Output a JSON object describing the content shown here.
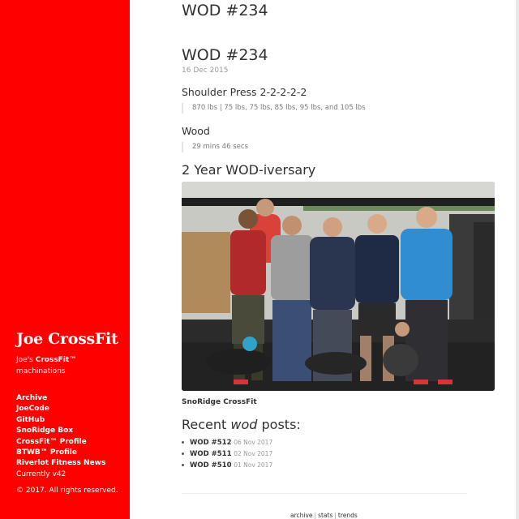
{
  "sidebar": {
    "brand": "Joe CrossFit",
    "tagline_prefix": "Joe's ",
    "tagline_strong": "CrossFit™",
    "tagline_suffix": "machinations",
    "nav": [
      "Archive",
      "JoeCode",
      "GitHub",
      "SnoRidge Box",
      "CrossFit™ Profile",
      "BTWB™ Profile",
      "Riverlot Fitness News"
    ],
    "version": "Currently v42",
    "copyright": "© 2017. All rights reserved.",
    "bg_color": "#ff0000"
  },
  "page": {
    "header_title": "WOD #234"
  },
  "post": {
    "title": "WOD #234",
    "date": "16 Dec 2015",
    "sections": [
      {
        "heading": "Shoulder Press 2-2-2-2-2",
        "quote": "870 lbs | 75 lbs, 75 lbs, 85 lbs, 95 lbs, and 105 lbs"
      },
      {
        "heading": "Wood",
        "quote": "29 mins 46 secs"
      }
    ],
    "subheading": "2 Year WOD-iversary",
    "photo_caption": "SnoRidge CrossFit"
  },
  "recent": {
    "title_prefix": "Recent ",
    "title_em": "wod",
    "title_suffix": " posts:",
    "items": [
      {
        "title": "WOD #512",
        "date": "06 Nov 2017"
      },
      {
        "title": "WOD #511",
        "date": "02 Nov 2017"
      },
      {
        "title": "WOD #510",
        "date": "01 Nov 2017"
      }
    ]
  },
  "footer": {
    "links": [
      "archive",
      "stats",
      "trends"
    ]
  }
}
